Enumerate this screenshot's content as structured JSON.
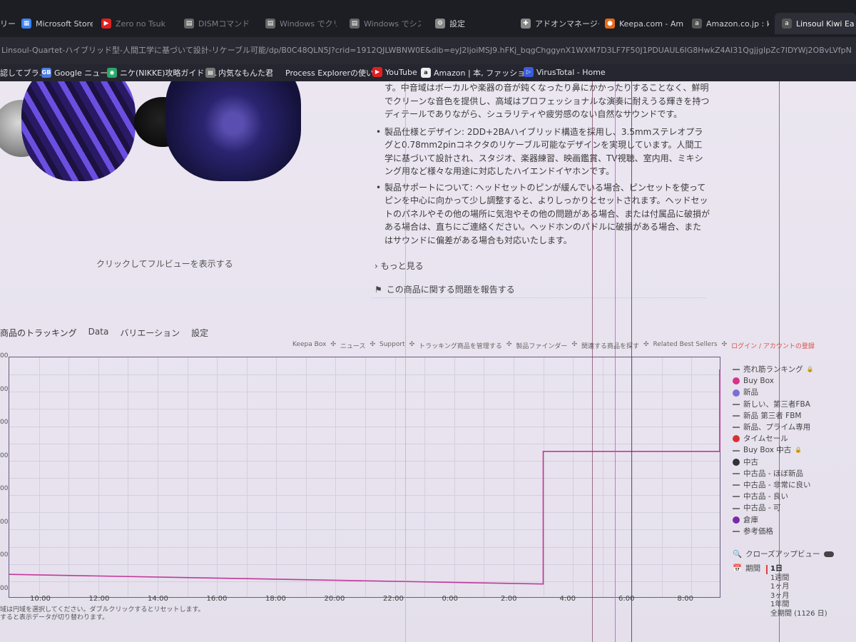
{
  "browser": {
    "tabs": [
      {
        "label": "リー",
        "favicon": "",
        "dim": false
      },
      {
        "label": "Microsoft Store",
        "favicon": "ms-store-icon",
        "dim": false
      },
      {
        "label": "Zero no Tsuk",
        "favicon": "youtube-icon",
        "dim": true
      },
      {
        "label": "DISMコマンド",
        "favicon": "page-icon",
        "dim": true
      },
      {
        "label": "Windows でクリー",
        "favicon": "page-icon",
        "dim": true
      },
      {
        "label": "Windows でシステ",
        "favicon": "page-icon",
        "dim": true
      },
      {
        "label": "設定",
        "favicon": "gear-icon",
        "dim": false
      },
      {
        "label": "アドオンマネージャー",
        "favicon": "puzzle-icon",
        "dim": false
      },
      {
        "label": "Keepa.com - Ama",
        "favicon": "firefox-icon",
        "dim": false
      },
      {
        "label": "Amazon.co.jp : ki",
        "favicon": "amazon-icon",
        "dim": false
      },
      {
        "label": "Linsoul Kiwi Ea",
        "favicon": "amazon-icon",
        "dim": false
      }
    ],
    "url": "Linsoul-Quartet-ハイブリッド型-人間工学に基づいて設計-リケーブル可能/dp/B0C48QLN5J?crid=1912QJLWBNW0E&dib=eyJ2IjoiMSJ9.hFKj_bqgChggynX1WXM7D3LF7F50J1PDUAUL6IG8HwkZ4AI31QgjjgIpZc7IDYWj2OBvLVfpN",
    "bookmarks": [
      {
        "label": "認してブラ...",
        "icon": ""
      },
      {
        "label": "Google ニュース",
        "icon": "google-news-icon"
      },
      {
        "label": "ニケ(NIKKE)攻略ガイド -...",
        "icon": "nikke-icon"
      },
      {
        "label": "内気なもんた君",
        "icon": "page-icon"
      },
      {
        "label": "Process Explorerの使い...",
        "icon": ""
      },
      {
        "label": "YouTube",
        "icon": "youtube-icon"
      },
      {
        "label": "Amazon | 本, ファッショ...",
        "icon": "amazon-icon"
      },
      {
        "label": "VirusTotal - Home",
        "icon": "virustotal-icon"
      }
    ]
  },
  "product": {
    "gallery_link": "クリックしてフルビューを表示する",
    "desc_top": "す。中音域はボーカルや楽器の音が鈍くなったり鼻にかかったりすることなく、鮮明でクリーンな音色を提供し、高域はプロフェッショナルな演奏に耐えうる輝きを持つディテールでありながら、シュラリティや疲労感のない自然なサウンドです。",
    "bullets": [
      "製品仕様とデザイン: 2DD+2BAハイブリッド構造を採用し、3.5mmステレオプラグと0.78mm2pinコネクタのリケーブル可能なデザインを実現しています。人間工学に基づいて設計され、スタジオ、楽器練習、映画鑑賞、TV視聴、室内用、ミキシング用など様々な用途に対応したハイエンドイヤホンです。",
      "製品サポートについて: ヘッドセットのピンが緩んでいる場合、ピンセットを使ってピンを中心に向かって少し調整すると、よりしっかりとセットされます。ヘッドセットのパネルやその他の場所に気泡やその他の問題がある場合、または付属品に破損がある場合は、直ちにご連絡ください。ヘッドホンのパドルに破損がある場合、またはサウンドに偏差がある場合も対応いたします。"
    ],
    "see_more": "もっと見る",
    "report": "この商品に関する問題を報告する"
  },
  "keepa": {
    "tabs": [
      "商品のトラッキング",
      "Data",
      "バリエーション",
      "設定"
    ],
    "links": [
      "Keepa Box",
      "ニュース",
      "Support",
      "トラッキング商品を管理する",
      "製品ファインダー",
      "関連する商品を探す",
      "Related Best Sellers"
    ],
    "login": "ログイン / アカウントの登録",
    "legend": [
      {
        "label": "売れ筋ランキング",
        "kind": "dash",
        "color": "#777777",
        "lock": true
      },
      {
        "label": "Buy Box",
        "kind": "dot",
        "color": "#d6338a",
        "lock": false
      },
      {
        "label": "新品",
        "kind": "dot",
        "color": "#7b6fd6",
        "lock": false
      },
      {
        "label": "新しい、第三者FBA",
        "kind": "dash",
        "color": "#777777",
        "lock": false
      },
      {
        "label": "新品 第三者 FBM",
        "kind": "dash",
        "color": "#777777",
        "lock": false
      },
      {
        "label": "新品、プライム専用",
        "kind": "dash",
        "color": "#777777",
        "lock": false
      },
      {
        "label": "タイムセール",
        "kind": "dot",
        "color": "#d93030",
        "lock": false
      },
      {
        "label": "Buy Box 中古",
        "kind": "dash",
        "color": "#777777",
        "lock": true
      },
      {
        "label": "中古",
        "kind": "dot",
        "color": "#333333",
        "lock": false
      },
      {
        "label": "中古品 - ほぼ新品",
        "kind": "dash",
        "color": "#777777",
        "lock": false
      },
      {
        "label": "中古品 - 非常に良い",
        "kind": "dash",
        "color": "#777777",
        "lock": false
      },
      {
        "label": "中古品 - 良い",
        "kind": "dash",
        "color": "#777777",
        "lock": false
      },
      {
        "label": "中古品 - 可",
        "kind": "dash",
        "color": "#777777",
        "lock": false
      },
      {
        "label": "倉庫",
        "kind": "dot",
        "color": "#7a2aa8",
        "lock": false
      },
      {
        "label": "参考価格",
        "kind": "dash",
        "color": "#777777",
        "lock": false
      }
    ],
    "closeup": "クローズアップビュー",
    "period_label": "期間",
    "periods": [
      "1日",
      "1週間",
      "1ヶ月",
      "3ヶ月",
      "1年間",
      "全期間 (1126 日)"
    ],
    "selected_period": "1日",
    "hint_line1": "域は円域を選択してください。ダブルクリックするとリセットします。",
    "hint_line2": "すると表示データが切り替わります。"
  },
  "chart_data": {
    "type": "line",
    "x_ticks": [
      "10:00",
      "12:00",
      "14:00",
      "16:00",
      "18:00",
      "20:00",
      "22:00",
      "0:00",
      "2:00",
      "4:00",
      "6:00",
      "8:00"
    ],
    "y_ticks": [
      "00",
      "00",
      "00",
      "00",
      "00",
      "00",
      "00",
      "00"
    ],
    "series": [
      {
        "color": "#c0399a",
        "points": [
          {
            "x": "9:00",
            "y": 0.1
          },
          {
            "x": "3:00",
            "y": 0.06
          },
          {
            "x": "3:00",
            "y": 0.61
          },
          {
            "x": "9:00",
            "y": 0.61
          },
          {
            "x": "9:00",
            "y": 0.95
          }
        ]
      }
    ],
    "grid": true
  }
}
